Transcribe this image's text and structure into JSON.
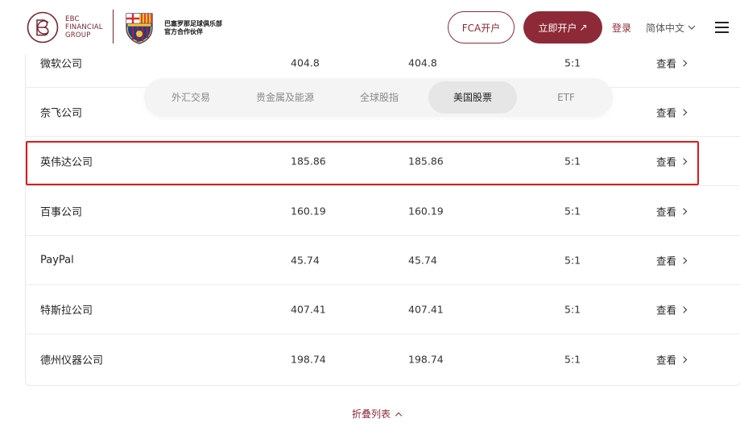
{
  "header": {
    "logo_lines": [
      "EBC",
      "FINANCIAL",
      "GROUP"
    ],
    "partner_lines": [
      "巴塞罗那足球俱乐部",
      "官方合作伙伴"
    ],
    "fca_label": "FCA开户",
    "open_account_label": "立即开户",
    "open_account_arrow": "↗",
    "login_label": "登录",
    "language_label": "简体中文"
  },
  "tabs": [
    {
      "label": "外汇交易",
      "active": false
    },
    {
      "label": "贵金属及能源",
      "active": false
    },
    {
      "label": "全球股指",
      "active": false
    },
    {
      "label": "美国股票",
      "active": true
    },
    {
      "label": "ETF",
      "active": false
    }
  ],
  "table": {
    "view_label": "查看",
    "rows": [
      {
        "name": "微软公司",
        "bid": "404.8",
        "ask": "404.8",
        "leverage": "5:1"
      },
      {
        "name": "奈飞公司",
        "bid": "",
        "ask": "",
        "leverage": ""
      },
      {
        "name": "英伟达公司",
        "bid": "185.86",
        "ask": "185.86",
        "leverage": "5:1"
      },
      {
        "name": "百事公司",
        "bid": "160.19",
        "ask": "160.19",
        "leverage": "5:1"
      },
      {
        "name": "PayPal",
        "bid": "45.74",
        "ask": "45.74",
        "leverage": "5:1"
      },
      {
        "name": "特斯拉公司",
        "bid": "407.41",
        "ask": "407.41",
        "leverage": "5:1"
      },
      {
        "name": "德州仪器公司",
        "bid": "198.74",
        "ask": "198.74",
        "leverage": "5:1"
      }
    ]
  },
  "collapse_label": "折叠列表",
  "colors": {
    "brand": "#8e2a37",
    "highlight": "#e01818"
  }
}
